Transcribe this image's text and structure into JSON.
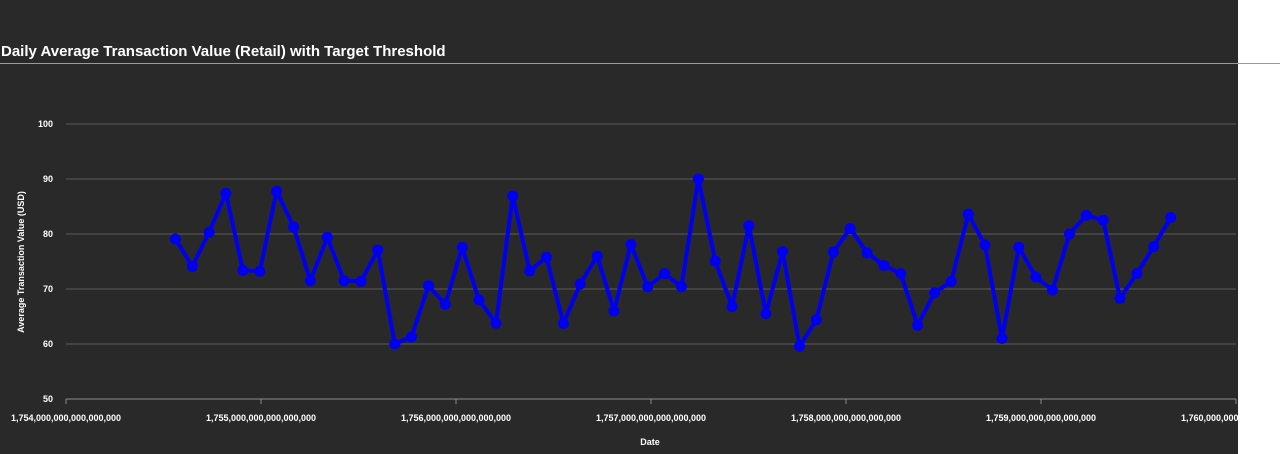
{
  "chart_data": {
    "type": "line",
    "title": "Daily Average Transaction Value (Retail) with Target Threshold",
    "xlabel": "Date",
    "ylabel": "Average Transaction Value (USD)",
    "xlim": [
      1754000000000000000,
      1760000000000000000
    ],
    "ylim": [
      50,
      100
    ],
    "x_ticks": [
      1754000000000000000,
      1755000000000000000,
      1756000000000000000,
      1757000000000000000,
      1758000000000000000,
      1759000000000000000,
      1760000000000000000
    ],
    "x_tick_labels": [
      "1,754,000,000,000,000,000",
      "1,755,000,000,000,000,000",
      "1,756,000,000,000,000,000",
      "1,757,000,000,000,000,000",
      "1,758,000,000,000,000,000",
      "1,759,000,000,000,000,000",
      "1,760,000,000,000,000,000"
    ],
    "y_ticks": [
      50,
      60,
      70,
      80,
      90,
      100
    ],
    "y_tick_labels": [
      "50",
      "60",
      "70",
      "80",
      "90",
      "100"
    ],
    "grid": true,
    "color": "#0000ee",
    "series": [
      {
        "x": [
          1754561000000000000,
          1754648000000000000,
          1754734000000000000,
          1754820000000000000,
          1754907000000000000,
          1754994000000000000,
          1755080000000000000,
          1755167000000000000,
          1755253000000000000,
          1755340000000000000,
          1755426000000000000,
          1755513000000000000,
          1755599000000000000,
          1755686000000000000,
          1755772000000000000,
          1755859000000000000,
          1755945000000000000,
          1756032000000000000,
          1756118000000000000,
          1756205000000000000,
          1756291000000000000,
          1756378000000000000,
          1756464000000000000,
          1756551000000000000,
          1756637000000000000,
          1756724000000000000,
          1756810000000000000,
          1756897000000000000,
          1756983000000000000,
          1757070000000000000,
          1757156000000000000,
          1757243000000000000,
          1757329000000000000,
          1757416000000000000,
          1757502000000000000,
          1757589000000000000,
          1757675000000000000,
          1757762000000000000,
          1757848000000000000,
          1757935000000000000,
          1758021000000000000,
          1758108000000000000,
          1758194000000000000,
          1758281000000000000,
          1758367000000000000,
          1758454000000000000,
          1758540000000000000,
          1758627000000000000,
          1758713000000000000,
          1758800000000000000,
          1758886000000000000,
          1758973000000000000,
          1759059000000000000,
          1759146000000000000,
          1759232000000000000,
          1759319000000000000,
          1759405000000000000,
          1759492000000000000,
          1759578000000000000,
          1759665000000000000
        ],
        "values": [
          79.1,
          74.1,
          80.3,
          87.4,
          73.4,
          73.2,
          87.8,
          81.3,
          71.5,
          79.4,
          71.5,
          71.4,
          77.1,
          60.0,
          61.3,
          70.6,
          67.2,
          77.6,
          68.0,
          63.8,
          86.9,
          73.3,
          75.8,
          63.7,
          70.9,
          76.0,
          66.0,
          78.1,
          70.4,
          72.8,
          70.4,
          90.0,
          75.1,
          66.8,
          81.5,
          65.5,
          76.8,
          59.6,
          64.4,
          76.7,
          81.0,
          76.6,
          74.3,
          72.8,
          63.4,
          69.3,
          71.4,
          83.6,
          78.0,
          61.0,
          77.6,
          72.2,
          69.8,
          80.0,
          83.4,
          82.5,
          68.3,
          72.8,
          77.7,
          83.0
        ]
      }
    ]
  }
}
